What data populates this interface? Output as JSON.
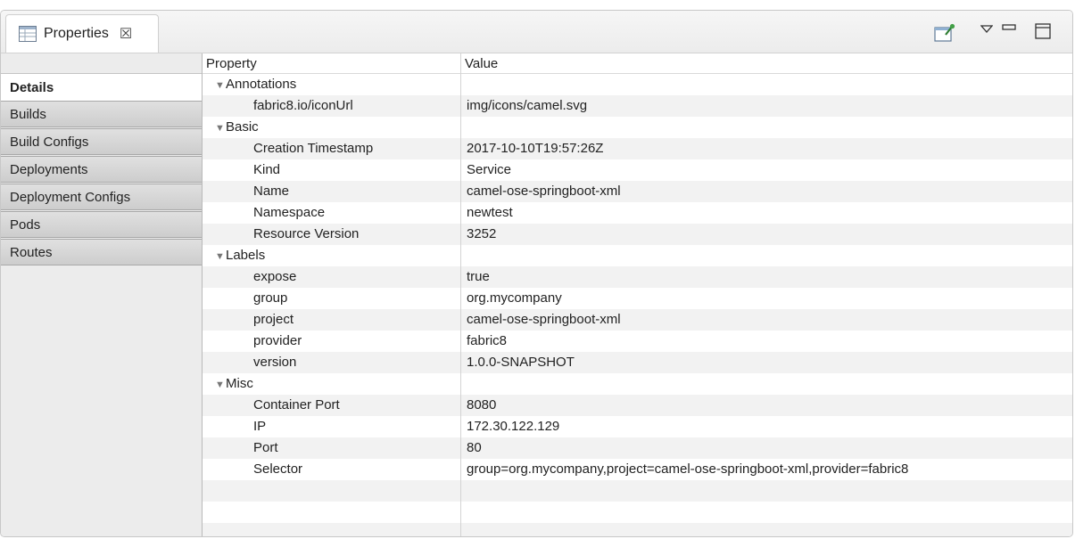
{
  "window": {
    "tab_label": "Properties",
    "tab_close_glyph": "☒",
    "tab_icon": "properties-table-icon",
    "toolbar": {
      "pin_icon": "pin-to-view-icon",
      "view_menu_icon": "view-menu-triangle-icon",
      "minimize_icon": "minimize-icon",
      "maximize_icon": "maximize-icon"
    }
  },
  "sidebar": {
    "items": [
      {
        "label": "Details",
        "selected": true
      },
      {
        "label": "Builds",
        "selected": false
      },
      {
        "label": "Build Configs",
        "selected": false
      },
      {
        "label": "Deployments",
        "selected": false
      },
      {
        "label": "Deployment Configs",
        "selected": false
      },
      {
        "label": "Pods",
        "selected": false
      },
      {
        "label": "Routes",
        "selected": false
      }
    ]
  },
  "table": {
    "columns": {
      "property": "Property",
      "value": "Value"
    },
    "toggle_glyph": "▼",
    "rows": [
      {
        "kind": "group",
        "property": "Annotations",
        "value": ""
      },
      {
        "kind": "child",
        "property": "fabric8.io/iconUrl",
        "value": "img/icons/camel.svg"
      },
      {
        "kind": "group",
        "property": "Basic",
        "value": ""
      },
      {
        "kind": "child",
        "property": "Creation Timestamp",
        "value": "2017-10-10T19:57:26Z"
      },
      {
        "kind": "child",
        "property": "Kind",
        "value": "Service"
      },
      {
        "kind": "child",
        "property": "Name",
        "value": "camel-ose-springboot-xml"
      },
      {
        "kind": "child",
        "property": "Namespace",
        "value": "newtest"
      },
      {
        "kind": "child",
        "property": "Resource Version",
        "value": "3252"
      },
      {
        "kind": "group",
        "property": "Labels",
        "value": ""
      },
      {
        "kind": "child",
        "property": "expose",
        "value": "true"
      },
      {
        "kind": "child",
        "property": "group",
        "value": "org.mycompany"
      },
      {
        "kind": "child",
        "property": "project",
        "value": "camel-ose-springboot-xml"
      },
      {
        "kind": "child",
        "property": "provider",
        "value": "fabric8"
      },
      {
        "kind": "child",
        "property": "version",
        "value": "1.0.0-SNAPSHOT"
      },
      {
        "kind": "group",
        "property": "Misc",
        "value": ""
      },
      {
        "kind": "child",
        "property": "Container Port",
        "value": "8080"
      },
      {
        "kind": "child",
        "property": "IP",
        "value": "172.30.122.129"
      },
      {
        "kind": "child",
        "property": "Port",
        "value": "80"
      },
      {
        "kind": "child",
        "property": "Selector",
        "value": "group=org.mycompany,project=camel-ose-springboot-xml,provider=fabric8"
      }
    ]
  }
}
